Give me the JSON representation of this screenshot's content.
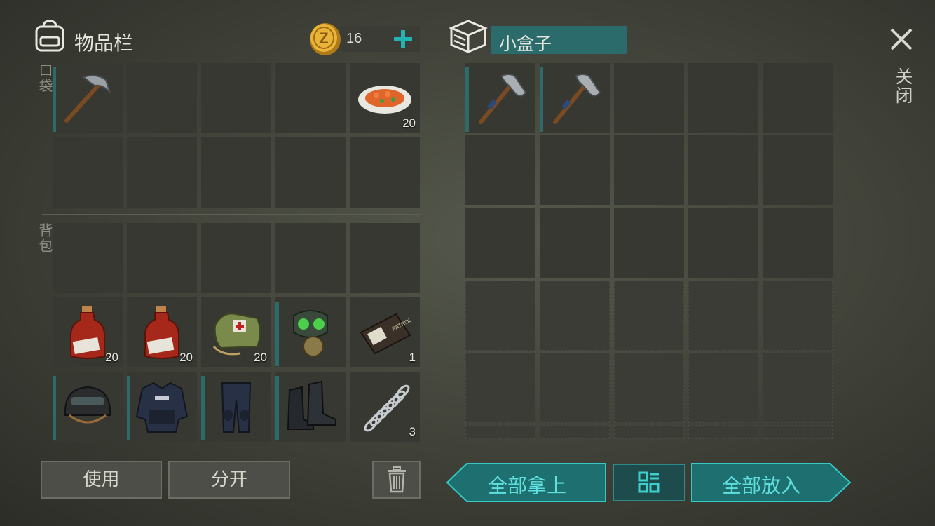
{
  "inventory": {
    "title": "物品栏",
    "coins": "16",
    "pocket_label": "口袋",
    "backpack_label": "背包",
    "pocket_slots": [
      {
        "item": "pickaxe",
        "count": ""
      },
      {
        "item": "",
        "count": ""
      },
      {
        "item": "",
        "count": ""
      },
      {
        "item": "",
        "count": ""
      },
      {
        "item": "food-plate",
        "count": "20"
      },
      {
        "item": "",
        "count": ""
      },
      {
        "item": "",
        "count": ""
      },
      {
        "item": "",
        "count": ""
      },
      {
        "item": "",
        "count": ""
      },
      {
        "item": "",
        "count": ""
      }
    ],
    "backpack_slots": [
      {
        "item": "",
        "count": ""
      },
      {
        "item": "",
        "count": ""
      },
      {
        "item": "",
        "count": ""
      },
      {
        "item": "",
        "count": ""
      },
      {
        "item": "",
        "count": ""
      },
      {
        "item": "spirit-bottle",
        "count": "20"
      },
      {
        "item": "spirit-bottle",
        "count": "20"
      },
      {
        "item": "medkit-bag",
        "count": "20"
      },
      {
        "item": "gas-mask",
        "count": ""
      },
      {
        "item": "police-wallet",
        "count": "1"
      },
      {
        "item": "helmet",
        "count": ""
      },
      {
        "item": "police-vest",
        "count": ""
      },
      {
        "item": "police-pants",
        "count": ""
      },
      {
        "item": "boots",
        "count": ""
      },
      {
        "item": "spring",
        "count": "3"
      }
    ],
    "use_label": "使用",
    "split_label": "分开"
  },
  "container": {
    "title": "小盒子",
    "slots": [
      {
        "item": "hatchet",
        "count": ""
      },
      {
        "item": "hatchet",
        "count": ""
      }
    ],
    "take_all_label": "全部拿上",
    "put_all_label": "全部放入"
  },
  "close_label": "关闭",
  "colors": {
    "accent": "#21c2c0",
    "slot": "#363831",
    "bar": "#2f6a6b",
    "teal_button": "#1e6f70"
  }
}
